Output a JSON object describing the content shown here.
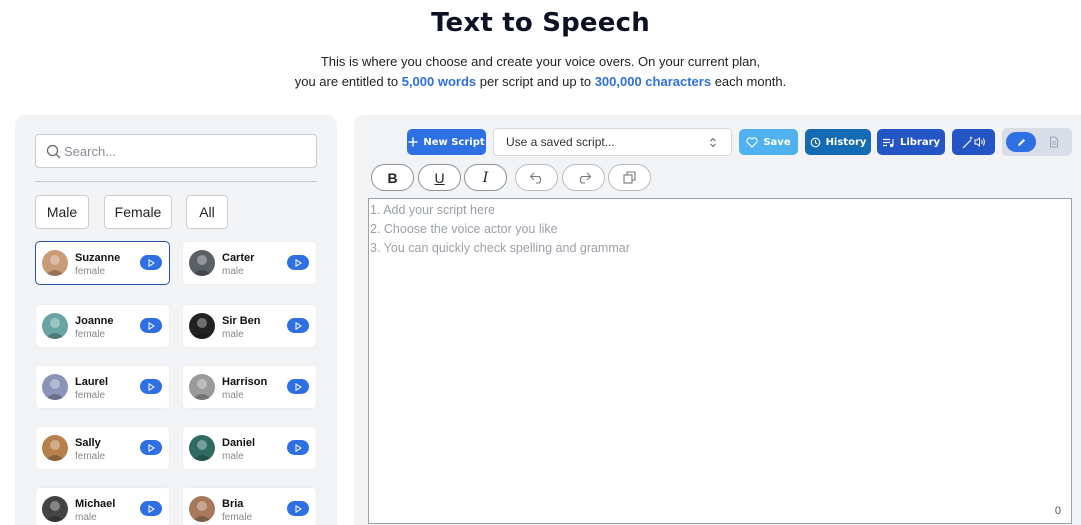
{
  "header": {
    "title": "Text to Speech",
    "subtitle_line1": "This is where you choose and create your voice overs. On your current plan,",
    "subtitle_pre": "you are entitled to",
    "words_limit": "5,000 words",
    "subtitle_mid": "per script and up to",
    "chars_limit": "300,000 characters",
    "subtitle_post": "each month."
  },
  "sidebar": {
    "search_placeholder": "Search...",
    "filters": [
      {
        "label": "Male"
      },
      {
        "label": "Female"
      },
      {
        "label": "All"
      }
    ],
    "voices": [
      {
        "name": "Suzanne",
        "gender": "female",
        "selected": true,
        "avatar_color": "#c89a76"
      },
      {
        "name": "Carter",
        "gender": "male",
        "avatar_color": "#5b5f66"
      },
      {
        "name": "Joanne",
        "gender": "female",
        "avatar_color": "#6aa3a3"
      },
      {
        "name": "Sir Ben",
        "gender": "male",
        "avatar_color": "#222222"
      },
      {
        "name": "Laurel",
        "gender": "female",
        "avatar_color": "#8a94b8"
      },
      {
        "name": "Harrison",
        "gender": "male",
        "avatar_color": "#9a9a9a"
      },
      {
        "name": "Sally",
        "gender": "female",
        "avatar_color": "#b7804d"
      },
      {
        "name": "Daniel",
        "gender": "male",
        "avatar_color": "#2f6b63"
      },
      {
        "name": "Michael",
        "gender": "male",
        "avatar_color": "#444444"
      },
      {
        "name": "Bria",
        "gender": "female",
        "avatar_color": "#a7785a"
      }
    ]
  },
  "toolbar": {
    "new_script": "New Script",
    "script_select_value": "Use a saved script...",
    "save": "Save",
    "history": "History",
    "library": "Library"
  },
  "editor": {
    "placeholder": "1. Add your script here\n2. Choose the voice actor you like\n3. You can quickly check spelling and grammar",
    "char_count": "0",
    "bold": "B",
    "underline": "U",
    "italic": "I"
  },
  "colors": {
    "accent": "#2f6fe4",
    "save": "#4fb2ef",
    "history": "#156bb3",
    "library": "#2455c4",
    "panel": "#f2f3f5"
  }
}
